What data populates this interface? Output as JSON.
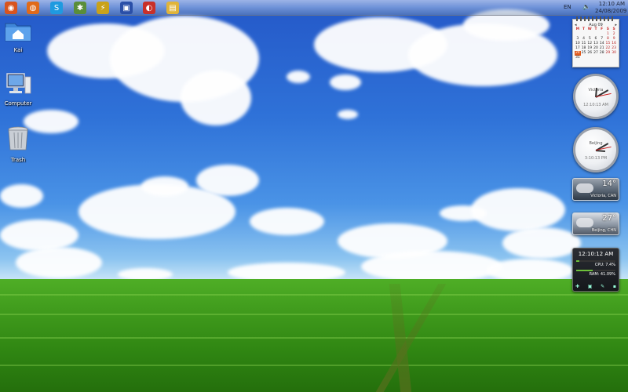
{
  "taskbar": {
    "launchers": [
      {
        "name": "ubuntu-icon",
        "glyph": "◉",
        "color": "#d8541e"
      },
      {
        "name": "firefox-icon",
        "glyph": "◍",
        "color": "#e06a1a"
      },
      {
        "name": "skype-icon",
        "glyph": "S",
        "color": "#1f9ae0"
      },
      {
        "name": "network-icon",
        "glyph": "✱",
        "color": "#5a8e3a"
      },
      {
        "name": "lightning-icon",
        "glyph": "⚡",
        "color": "#c9a21b"
      },
      {
        "name": "monitor-icon",
        "glyph": "▣",
        "color": "#2a4fa8"
      },
      {
        "name": "app-icon",
        "glyph": "◐",
        "color": "#c8302a"
      },
      {
        "name": "folder-icon",
        "glyph": "▤",
        "color": "#e0b43a"
      }
    ],
    "language": "EN",
    "time": "12:10 AM",
    "date": "24/08/2009"
  },
  "desktop_icons": [
    {
      "name": "home",
      "label": "Kai"
    },
    {
      "name": "computer",
      "label": "Computer"
    },
    {
      "name": "trash",
      "label": "Trash"
    }
  ],
  "calendar": {
    "month": "Aug 09",
    "dow": [
      "M",
      "T",
      "W",
      "T",
      "F",
      "S",
      "S"
    ],
    "weeks": [
      [
        "",
        "",
        "",
        "",
        "",
        "1",
        "2"
      ],
      [
        "3",
        "4",
        "5",
        "6",
        "7",
        "8",
        "9"
      ],
      [
        "10",
        "11",
        "12",
        "13",
        "14",
        "15",
        "16"
      ],
      [
        "17",
        "18",
        "19",
        "20",
        "21",
        "22",
        "23"
      ],
      [
        "24",
        "25",
        "26",
        "27",
        "28",
        "29",
        "30"
      ],
      [
        "31",
        "",
        "",
        "",
        "",
        "",
        ""
      ]
    ],
    "today": "24"
  },
  "clocks": [
    {
      "city": "Victoria",
      "time": "12:10:13 AM"
    },
    {
      "city": "Beijing",
      "time": "3:10:13 PM"
    }
  ],
  "weather": [
    {
      "temp": "14°",
      "location": "Victoria, CAN"
    },
    {
      "temp": "27°",
      "location": "Beijing, CHN"
    }
  ],
  "sysmon": {
    "time": "12:10:12 AM",
    "cpu": "CPU: 7.4%",
    "cpu_level": 0.074,
    "ram": "RAM: 41.09%",
    "ram_level": 0.4109
  }
}
